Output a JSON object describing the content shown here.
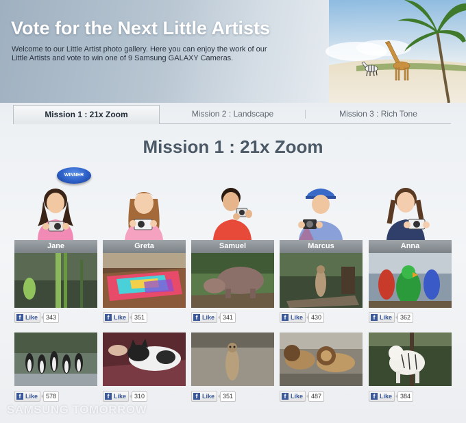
{
  "header": {
    "title": "Vote for the Next Little Artists",
    "description": "Welcome to our Little Artist photo gallery. Here you can enjoy the work of our Little Artists and vote to win one of 9 Samsung GALAXY Cameras."
  },
  "tabs": [
    {
      "label": "Mission 1 : 21x Zoom",
      "active": true
    },
    {
      "label": "Mission 2 : Landscape",
      "active": false
    },
    {
      "label": "Mission 3 : Rich Tone",
      "active": false
    }
  ],
  "mission_heading": "Mission 1 : 21x Zoom",
  "winner_badge": "WINNER",
  "artists": [
    {
      "name": "Jane",
      "winner": true
    },
    {
      "name": "Greta",
      "winner": false
    },
    {
      "name": "Samuel",
      "winner": false
    },
    {
      "name": "Marcus",
      "winner": false
    },
    {
      "name": "Anna",
      "winner": false
    }
  ],
  "like_label": "Like",
  "photos_row1": [
    {
      "artist": "Jane",
      "subject": "grass-closeup",
      "likes": "343"
    },
    {
      "artist": "Greta",
      "subject": "colorful-beads",
      "likes": "351"
    },
    {
      "artist": "Samuel",
      "subject": "hippo",
      "likes": "341"
    },
    {
      "artist": "Marcus",
      "subject": "meerkat-on-log",
      "likes": "430"
    },
    {
      "artist": "Anna",
      "subject": "parrots",
      "likes": "362"
    }
  ],
  "photos_row2": [
    {
      "artist": "Jane",
      "subject": "penguins",
      "likes": "578"
    },
    {
      "artist": "Greta",
      "subject": "cat",
      "likes": "310"
    },
    {
      "artist": "Samuel",
      "subject": "meerkat",
      "likes": "351"
    },
    {
      "artist": "Marcus",
      "subject": "lions",
      "likes": "487"
    },
    {
      "artist": "Anna",
      "subject": "white-tiger",
      "likes": "384"
    }
  ],
  "watermark": "SAMSUNG TOMORROW",
  "colors": {
    "facebook_blue": "#3b5998",
    "winner_blue": "#2c5fc7",
    "name_bar": "#8a9095",
    "heading": "#4b5966"
  }
}
